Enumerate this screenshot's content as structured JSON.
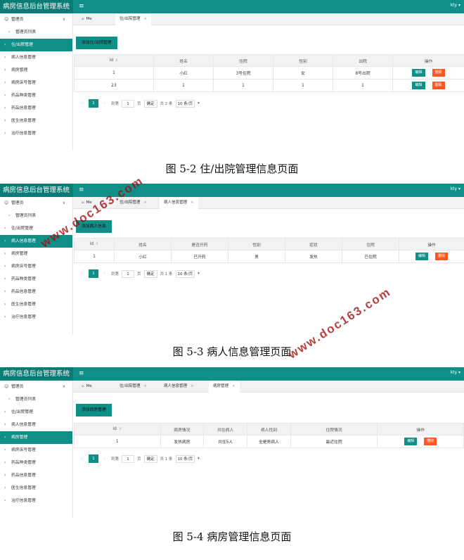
{
  "screens": [
    {
      "app_title": "病房信息后台管理系统",
      "user": "kty",
      "sidebar": [
        {
          "label": "管理员",
          "type": "group"
        },
        {
          "label": "管理员列表",
          "type": "sub"
        },
        {
          "label": "住/出院管理",
          "type": "item",
          "active": true
        },
        {
          "label": "病人信息管理",
          "type": "item"
        },
        {
          "label": "病房管理",
          "type": "item"
        },
        {
          "label": "病房床号管理",
          "type": "item"
        },
        {
          "label": "药品种类管理",
          "type": "item"
        },
        {
          "label": "药品信息管理",
          "type": "item"
        },
        {
          "label": "医生信息管理",
          "type": "item"
        },
        {
          "label": "治疗信息管理",
          "type": "item"
        }
      ],
      "tabs": [
        {
          "label": "Me",
          "home": true
        },
        {
          "label": "住/出院管理",
          "active": true
        }
      ],
      "add_button": "添加住/出院管理",
      "columns": [
        "id",
        "姓名",
        "住院",
        "性别",
        "出院",
        "操作"
      ],
      "rows": [
        [
          "1",
          "小红",
          "3号住院",
          "女",
          "8号出院"
        ],
        [
          "23",
          "1",
          "1",
          "1",
          "1"
        ]
      ],
      "edit_label": "编辑",
      "delete_label": "删除",
      "pager": {
        "page": "1",
        "goto_label": "到第",
        "page_input": "1",
        "page_unit": "页",
        "confirm": "确定",
        "total": "共 2 条",
        "size": "10 条/页"
      }
    },
    {
      "app_title": "病房信息后台管理系统",
      "user": "kty",
      "sidebar": [
        {
          "label": "管理员",
          "type": "group"
        },
        {
          "label": "管理员列表",
          "type": "sub"
        },
        {
          "label": "住/出院管理",
          "type": "item"
        },
        {
          "label": "病人信息管理",
          "type": "item",
          "active": true
        },
        {
          "label": "病房管理",
          "type": "item"
        },
        {
          "label": "病房床号管理",
          "type": "item"
        },
        {
          "label": "药品种类管理",
          "type": "item"
        },
        {
          "label": "药品信息管理",
          "type": "item"
        },
        {
          "label": "医生信息管理",
          "type": "item"
        },
        {
          "label": "治疗信息管理",
          "type": "item"
        }
      ],
      "tabs": [
        {
          "label": "Me",
          "home": true
        },
        {
          "label": "住/出院管理"
        },
        {
          "label": "病人信息管理",
          "active": true
        }
      ],
      "add_button": "添加病人信息",
      "columns": [
        "id",
        "姓名",
        "是否开药",
        "性别",
        "症状",
        "住院",
        "操作"
      ],
      "rows": [
        [
          "1",
          "小红",
          "已开药",
          "男",
          "发热",
          "已住院"
        ]
      ],
      "edit_label": "编辑",
      "delete_label": "删除",
      "pager": {
        "page": "1",
        "goto_label": "到第",
        "page_input": "1",
        "page_unit": "页",
        "confirm": "确定",
        "total": "共 1 条",
        "size": "10 条/页"
      }
    },
    {
      "app_title": "病房信息后台管理系统",
      "user": "kty",
      "sidebar": [
        {
          "label": "管理员",
          "type": "group"
        },
        {
          "label": "管理员列表",
          "type": "sub"
        },
        {
          "label": "住/出院管理",
          "type": "item"
        },
        {
          "label": "病人信息管理",
          "type": "item"
        },
        {
          "label": "病房管理",
          "type": "item",
          "active": true
        },
        {
          "label": "病房床号管理",
          "type": "item"
        },
        {
          "label": "药品种类管理",
          "type": "item"
        },
        {
          "label": "药品信息管理",
          "type": "item"
        },
        {
          "label": "医生信息管理",
          "type": "item"
        },
        {
          "label": "治疗信息管理",
          "type": "item"
        }
      ],
      "tabs": [
        {
          "label": "Me",
          "home": true
        },
        {
          "label": "住/出院管理"
        },
        {
          "label": "病人信息管理"
        },
        {
          "label": "病房管理",
          "active": true
        }
      ],
      "add_button": "添加病房管理",
      "columns": [
        "id",
        "病房情况",
        "共住病人",
        "病人性别",
        "住院情况",
        "操作"
      ],
      "rows": [
        [
          "1",
          "发热病房",
          "共住5人",
          "全是男病人",
          "最近住院"
        ]
      ],
      "edit_label": "编辑",
      "delete_label": "删除",
      "pager": {
        "page": "1",
        "goto_label": "到第",
        "page_input": "1",
        "page_unit": "页",
        "confirm": "确定",
        "total": "共 1 条",
        "size": "10 条/页"
      }
    }
  ],
  "captions": [
    "图 5-2 住/出院管理信息页面",
    "图 5-3 病人信息管理页面",
    "图 5-4 病房管理信息页面"
  ],
  "watermarks": [
    "www.doc163.com",
    "www.doc163.com"
  ],
  "colors": {
    "primary": "#0f8f88",
    "danger": "#ff5722",
    "watermark": "#a00b0b"
  }
}
